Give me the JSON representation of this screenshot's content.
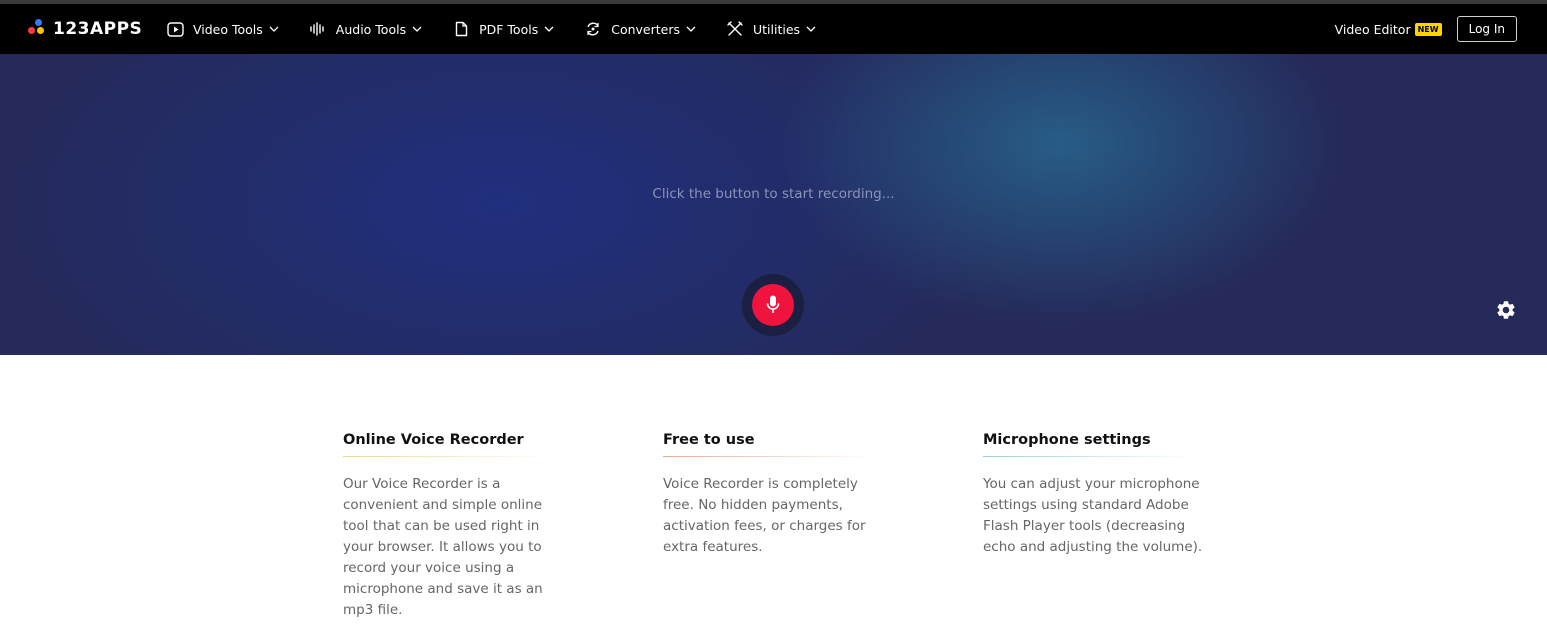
{
  "brand": {
    "name": "123APPS",
    "dot_colors": [
      "#2f7cf6",
      "#ff3a3a",
      "#ffc400"
    ]
  },
  "nav": {
    "items": [
      {
        "label": "Video Tools",
        "icon": "play-icon"
      },
      {
        "label": "Audio Tools",
        "icon": "waveform-icon"
      },
      {
        "label": "PDF Tools",
        "icon": "document-icon"
      },
      {
        "label": "Converters",
        "icon": "refresh-icon"
      },
      {
        "label": "Utilities",
        "icon": "tools-icon"
      }
    ],
    "video_editor": "Video Editor",
    "badge": "NEW",
    "login": "Log In"
  },
  "hero": {
    "prompt": "Click the button to start recording...",
    "record_icon": "microphone-icon",
    "settings_icon": "gear-icon",
    "record_color": "#f0133d"
  },
  "features": [
    {
      "title": "Online Voice Recorder",
      "text": "Our Voice Recorder is a convenient and simple online tool that can be used right in your browser. It allows you to record your voice using a microphone and save it as an mp3 file.",
      "accent": "#f7d774"
    },
    {
      "title": "Free to use",
      "text": "Voice Recorder is completely free. No hidden payments, activation fees, or charges for extra features.",
      "accent": "#f4a68a"
    },
    {
      "title": "Microphone settings",
      "text": "You can adjust your microphone settings using standard Adobe Flash Player tools (decreasing echo and adjusting the volume).",
      "accent": "#8fd2e6"
    }
  ]
}
